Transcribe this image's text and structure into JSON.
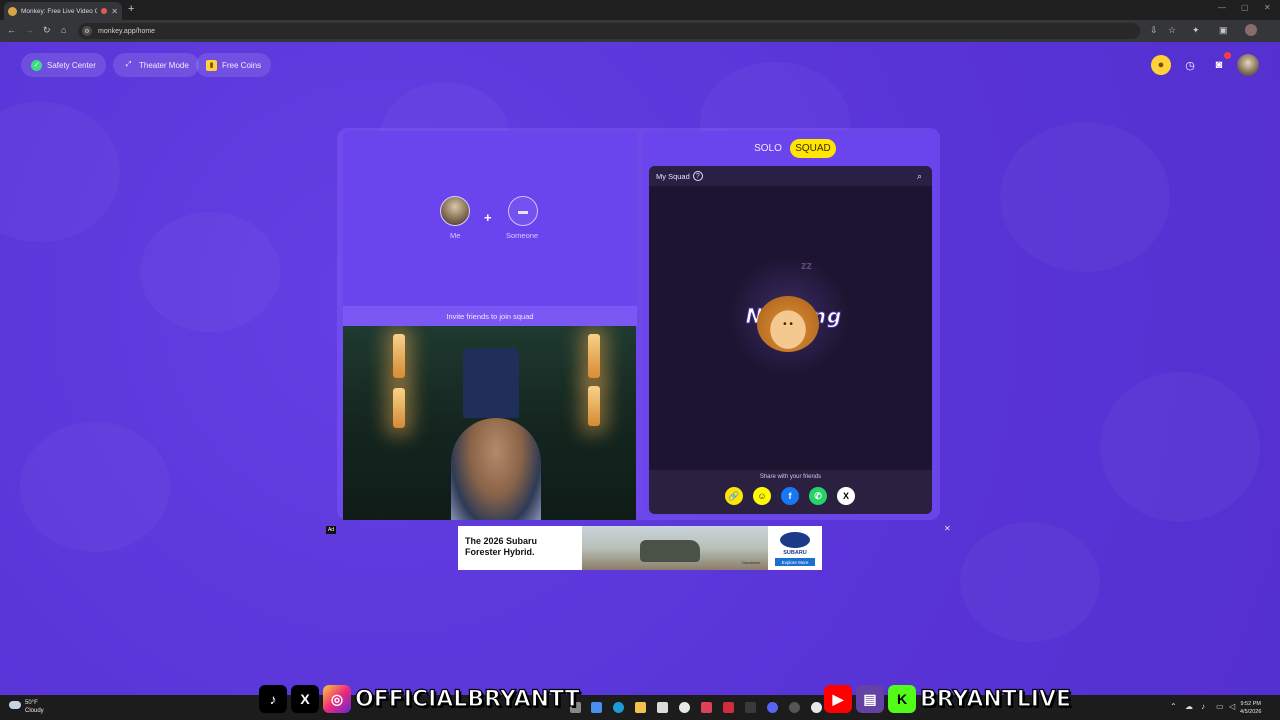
{
  "browser": {
    "tab_title": "Monkey: Free Live Video Ch",
    "tab_close": "✕",
    "new_tab": "+",
    "url": "monkey.app/home",
    "window_controls": [
      "—",
      "▢",
      "✕"
    ]
  },
  "toolbar": {
    "safety_center": "Safety Center",
    "theater_mode": "Theater Mode",
    "free_coins": "Free Coins"
  },
  "top_right_icons": [
    "coins-icon",
    "history-icon",
    "chat-icon",
    "profile-avatar"
  ],
  "squad_invite": {
    "me_label": "Me",
    "someone_label": "Someone",
    "plus": "+",
    "invite_text": "Invite friends to join squad"
  },
  "mode_toggle": {
    "solo": "SOLO",
    "squad": "SQUAD",
    "active": "SQUAD"
  },
  "my_squad": {
    "title": "My Squad",
    "help": "?",
    "empty_text": "Nothing",
    "zzz": "zz",
    "share_label": "Share with your friends",
    "share_targets": [
      "copy-link",
      "snapchat",
      "facebook",
      "whatsapp",
      "x"
    ]
  },
  "ad": {
    "tag": "Ad",
    "close": "✕",
    "headline": "The 2026 Subaru Forester Hybrid.",
    "brand": "SUBARU",
    "cta": "Explore More",
    "disclaimer": "Disclaimer"
  },
  "taskbar": {
    "temp": "50°F",
    "weather": "Cloudy",
    "time": "9:52 PM",
    "date": "4/5/2026"
  },
  "overlay": {
    "left_handle": "OFFICIALBRYANTT",
    "right_handle": "BRYANTLIVE"
  },
  "colors": {
    "page_bg": "#5a35d8",
    "accent_yellow": "#ffe600",
    "card": "#6a45ee",
    "squad_bg": "#1c1430"
  }
}
